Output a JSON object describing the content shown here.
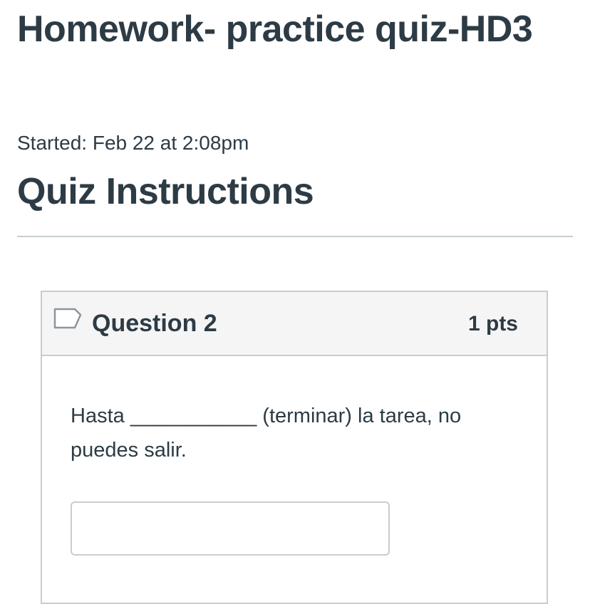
{
  "page": {
    "title": "Homework- practice quiz-HD3",
    "started": "Started: Feb 22 at 2:08pm",
    "instructions_heading": "Quiz Instructions"
  },
  "question": {
    "name": "Question 2",
    "points": "1 pts",
    "flag_icon": "flag-outline-icon",
    "text": "Hasta ___________ (terminar) la tarea, no puedes salir.",
    "answer_value": "",
    "answer_placeholder": ""
  },
  "colors": {
    "text": "#2d3b45",
    "border": "#c7cdd1",
    "header_bg": "#f5f5f5"
  }
}
